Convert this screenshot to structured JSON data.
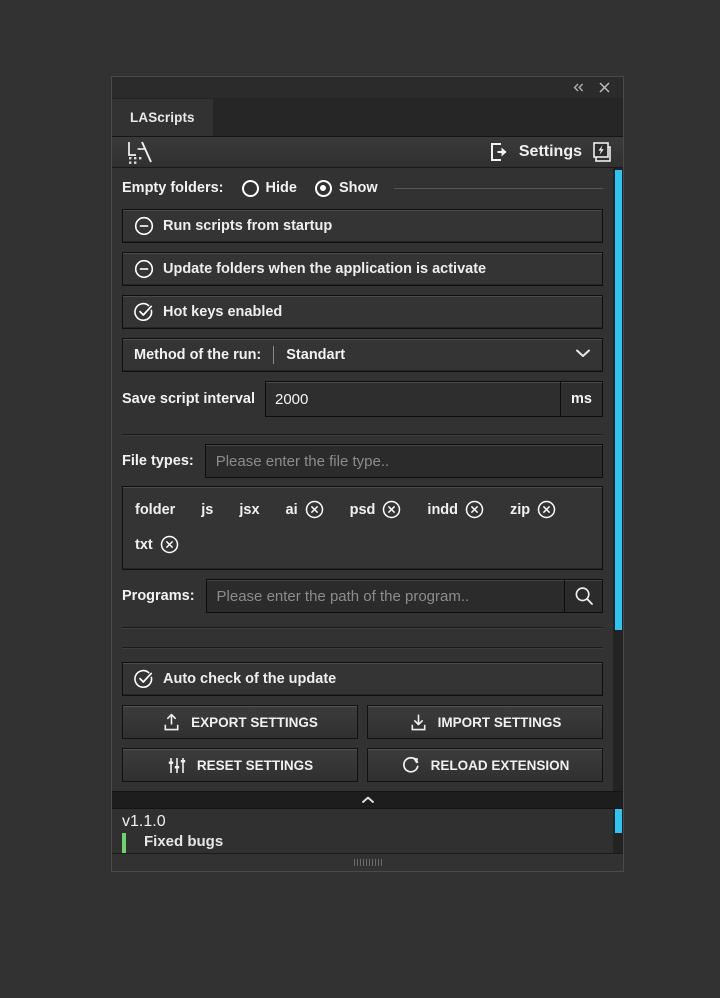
{
  "window": {
    "title_controls": {
      "collapse": "«",
      "close": "✕"
    },
    "tab_label": "LAScripts",
    "logo_name": "LA"
  },
  "header": {
    "settings_label": "Settings",
    "left_icon": "exit-arrow-icon",
    "right_icon": "lightning-layers-icon"
  },
  "empty_folders": {
    "label": "Empty folders:",
    "options": [
      {
        "label": "Hide",
        "selected": false
      },
      {
        "label": "Show",
        "selected": true
      }
    ]
  },
  "toggles": [
    {
      "label": "Run scripts from startup",
      "checked": false,
      "icon": "minus-circle-icon"
    },
    {
      "label": "Update folders when the application is activate",
      "checked": false,
      "icon": "minus-circle-icon"
    },
    {
      "label": "Hot keys enabled",
      "checked": true,
      "icon": "check-circle-icon"
    }
  ],
  "method_of_run": {
    "label": "Method of the run:",
    "value": "Standart",
    "chevron": "chevron-down-icon"
  },
  "save_interval": {
    "label": "Save script interval",
    "value": "2000",
    "unit": "ms"
  },
  "file_types": {
    "label": "File types:",
    "placeholder": "Please enter the file type..",
    "value": "",
    "tags": [
      {
        "label": "folder",
        "removable": false
      },
      {
        "label": "js",
        "removable": false
      },
      {
        "label": "jsx",
        "removable": false
      },
      {
        "label": "ai",
        "removable": true
      },
      {
        "label": "psd",
        "removable": true
      },
      {
        "label": "indd",
        "removable": true
      },
      {
        "label": "zip",
        "removable": true
      },
      {
        "label": "txt",
        "removable": true
      }
    ]
  },
  "programs": {
    "label": "Programs:",
    "placeholder": "Please enter the path of the program..",
    "value": "",
    "search_icon": "search-icon"
  },
  "auto_update": {
    "label": "Auto check of the update",
    "checked": true,
    "icon": "check-circle-icon"
  },
  "actions": [
    {
      "label": "EXPORT SETTINGS",
      "icon": "upload-icon"
    },
    {
      "label": "IMPORT SETTINGS",
      "icon": "download-icon"
    },
    {
      "label": "RESET SETTINGS",
      "icon": "sliders-icon"
    },
    {
      "label": "RELOAD EXTENSION",
      "icon": "refresh-icon"
    }
  ],
  "collapse_bar": {
    "icon": "chevron-up-icon"
  },
  "changelog": {
    "version": "v1.1.0",
    "entry": "Fixed bugs"
  },
  "statusbar": {
    "grip": "resize-grip"
  },
  "colors": {
    "accent": "#2ec4f3",
    "panel_bg": "#323232",
    "field_bg": "#2b2b2b",
    "text": "#f0f0f0",
    "placeholder": "#8c8c8c",
    "changelog_bar": "#6ed56e"
  }
}
